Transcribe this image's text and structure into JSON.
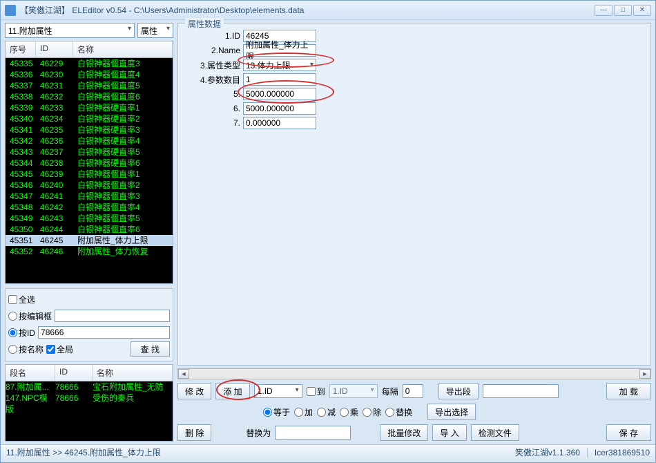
{
  "window": {
    "title": "【笑傲江湖】 ELEditor v0.54 - C:\\Users\\Administrator\\Desktop\\elements.data"
  },
  "left": {
    "category_combo": "11.附加属性",
    "attr_combo": "属性",
    "headers": {
      "seq": "序号",
      "id": "ID",
      "name": "名称"
    },
    "rows": [
      {
        "seq": "45335",
        "id": "46229",
        "name": "白银神器僵直度3"
      },
      {
        "seq": "45336",
        "id": "46230",
        "name": "白银神器僵直度4"
      },
      {
        "seq": "45337",
        "id": "46231",
        "name": "白银神器僵直度5"
      },
      {
        "seq": "45338",
        "id": "46232",
        "name": "白银神器僵直度6"
      },
      {
        "seq": "45339",
        "id": "46233",
        "name": "白银神器硬直率1"
      },
      {
        "seq": "45340",
        "id": "46234",
        "name": "白银神器硬直率2"
      },
      {
        "seq": "45341",
        "id": "46235",
        "name": "白银神器硬直率3"
      },
      {
        "seq": "45342",
        "id": "46236",
        "name": "白银神器硬直率4"
      },
      {
        "seq": "45343",
        "id": "46237",
        "name": "白银神器硬直率5"
      },
      {
        "seq": "45344",
        "id": "46238",
        "name": "白银神器硬直率6"
      },
      {
        "seq": "45345",
        "id": "46239",
        "name": "白银神器僵直率1"
      },
      {
        "seq": "45346",
        "id": "46240",
        "name": "白银神器僵直率2"
      },
      {
        "seq": "45347",
        "id": "46241",
        "name": "白银神器僵直率3"
      },
      {
        "seq": "45348",
        "id": "46242",
        "name": "白银神器僵直率4"
      },
      {
        "seq": "45349",
        "id": "46243",
        "name": "白银神器僵直率5"
      },
      {
        "seq": "45350",
        "id": "46244",
        "name": "白银神器僵直率6"
      },
      {
        "seq": "45351",
        "id": "46245",
        "name": "附加属性_体力上限",
        "selected": true
      },
      {
        "seq": "45352",
        "id": "46246",
        "name": "附加属性_体力恢复"
      }
    ],
    "filters": {
      "select_all": "全选",
      "by_edit": "按编辑框",
      "by_id": "按ID",
      "id_value": "78666",
      "by_name": "按名称",
      "global": "全局",
      "search": "查 找"
    },
    "search": {
      "headers": {
        "seg": "段名",
        "id": "ID",
        "name": "名称"
      },
      "rows": [
        {
          "seg": "87.附加属...",
          "id": "78666",
          "name": "宝石附加属性_无防"
        },
        {
          "seg": "147.NPC模版",
          "id": "78666",
          "name": "受伤的秦兵"
        }
      ]
    }
  },
  "props": {
    "legend": "属性数据",
    "fields": [
      {
        "label": "1.ID",
        "value": "46245"
      },
      {
        "label": "2.Name",
        "value": "附加属性_体力上限"
      },
      {
        "label": "3.属性类型",
        "value": "13.体力上限",
        "combo": true
      },
      {
        "label": "4.参数数目",
        "value": "1"
      },
      {
        "label": "5.",
        "value": "5000.000000"
      },
      {
        "label": "6.",
        "value": "5000.000000"
      },
      {
        "label": "7.",
        "value": "0.000000"
      }
    ]
  },
  "buttons": {
    "modify": "修 改",
    "add": "添 加",
    "id_combo": "1.ID",
    "to": "到",
    "id_combo2": "1.ID",
    "interval": "每隔",
    "interval_val": "0",
    "export_seg": "导出段",
    "load": "加 载",
    "ops": {
      "eq": "等于",
      "add": "加",
      "sub": "减",
      "mul": "乘",
      "div": "除",
      "rep": "替换"
    },
    "export_sel": "导出选择",
    "delete": "删 除",
    "replace_as": "替换为",
    "batch": "批量修改",
    "import": "导 入",
    "check_file": "检测文件",
    "save": "保 存"
  },
  "status": {
    "path": "11.附加属性 >> 46245.附加属性_体力上限",
    "version": "笑傲江湖v1.1.360",
    "author": "Icer381869510"
  }
}
